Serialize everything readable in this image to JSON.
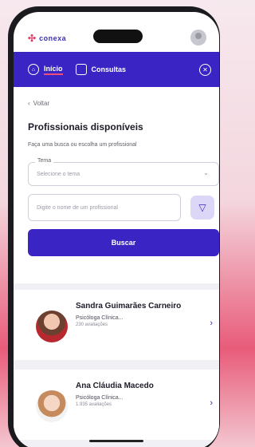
{
  "app": {
    "logo_text": "conexa"
  },
  "nav": {
    "items": [
      {
        "label": "Início"
      },
      {
        "label": "Consultas"
      }
    ]
  },
  "page": {
    "back_label": "Voltar",
    "title": "Profissionais disponíveis",
    "subtitle": "Faça uma busca ou escolha um profissional"
  },
  "form": {
    "theme_label": "Tema",
    "theme_value": "Selecione o tema",
    "search_placeholder": "Digite o nome de um profissional",
    "submit_label": "Buscar"
  },
  "professionals": [
    {
      "name": "Sandra Guimarães Carneiro",
      "role": "Psicóloga Clínica...",
      "ratings": "230 avaliações"
    },
    {
      "name": "Ana Cláudia Macedo",
      "role": "Psicóloga Clínica...",
      "ratings": "1.935 avaliações"
    }
  ],
  "colors": {
    "primary": "#3a25c4",
    "accent": "#ef4f79"
  }
}
